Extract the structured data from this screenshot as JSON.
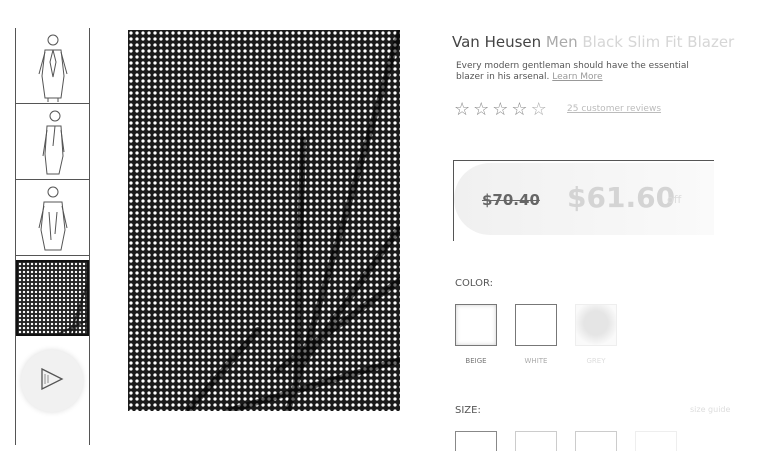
{
  "product": {
    "title_main": "Van Heusen ",
    "title_mid": "Men ",
    "title_faded": "Black Slim Fit Blazer",
    "description": "Every modern gentleman should have the essential blazer ",
    "description_faded": "in his arsenal. ",
    "learn_more": "Learn More",
    "rating": 0,
    "max_rating": 5,
    "reviews_text": "25 customer reviews"
  },
  "price": {
    "original": "$70.40",
    "current": "$61.60",
    "discount": "off"
  },
  "color": {
    "label": "COLOR:",
    "options": [
      {
        "name": "BEIGE",
        "hex": "#ffffff"
      },
      {
        "name": "WHITE",
        "hex": "#ffffff"
      },
      {
        "name": "GREY",
        "hex": "#e5e5e5"
      }
    ]
  },
  "size": {
    "label": "SIZE:",
    "guide": "size guide"
  },
  "gallery": {
    "thumbnails": [
      "front view",
      "side view",
      "back view",
      "fabric detail"
    ],
    "selected_index": 3,
    "video_icon": "play-icon"
  }
}
